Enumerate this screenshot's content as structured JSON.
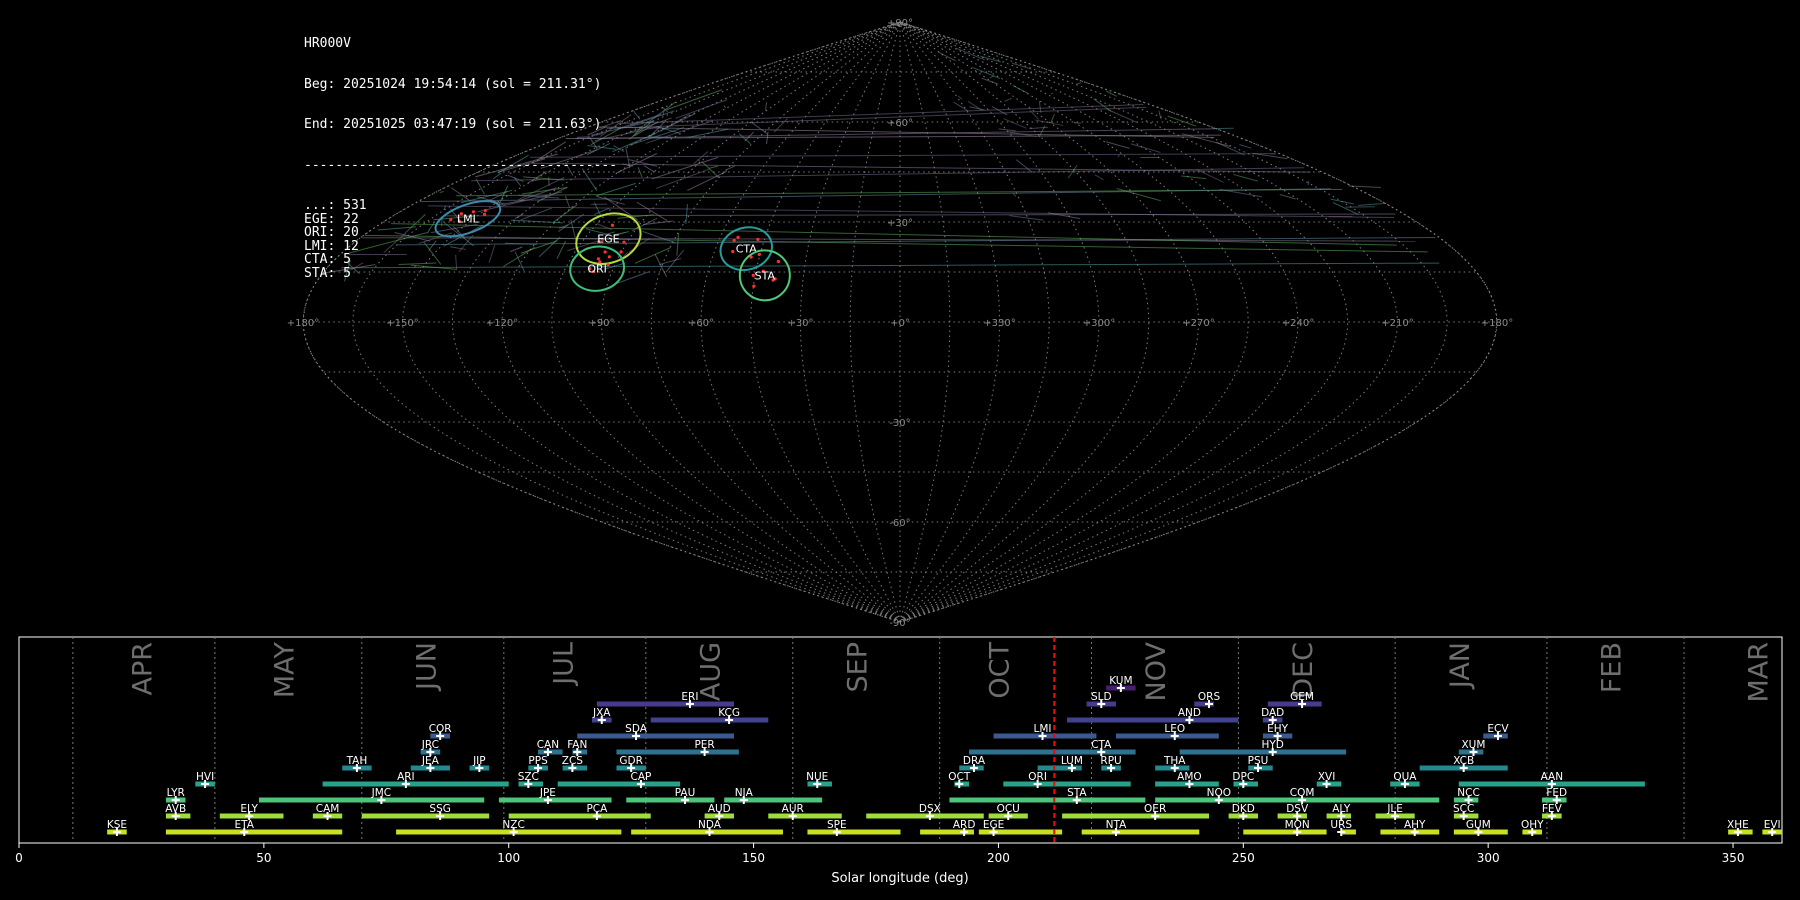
{
  "header": {
    "station": "HR000V",
    "begin": "Beg: 20251024 19:54:14 (sol = 211.31°)",
    "end": "End: 20251025 03:47:19 (sol = 211.63°)",
    "separator": "----------------------------------------",
    "counts": [
      {
        "code": "...",
        "n": 531
      },
      {
        "code": "EGE",
        "n": 22
      },
      {
        "code": "ORI",
        "n": 20
      },
      {
        "code": "LMI",
        "n": 12
      },
      {
        "code": "CTA",
        "n": 5
      },
      {
        "code": "STA",
        "n": 5
      }
    ]
  },
  "sky_map": {
    "projection": "sinusoidal",
    "lat_labels": [
      "+90°",
      "+60°",
      "+30°",
      "-30°",
      "-60°",
      "-90°"
    ],
    "lon_labels": [
      "+180°",
      "+150°",
      "+120°",
      "+90°",
      "+60°",
      "+30°",
      "+0°",
      "+330°",
      "+300°",
      "+270°",
      "+240°",
      "+210°",
      "+180°"
    ],
    "showers": [
      {
        "code": "LML",
        "lon": 152,
        "lat": 31,
        "color": "#3b8bb0"
      },
      {
        "code": "EGE",
        "lon": 97,
        "lat": 25,
        "color": "#b3dc3c"
      },
      {
        "code": "ORI",
        "lon": 95,
        "lat": 16,
        "color": "#3bbf7a"
      },
      {
        "code": "CTA",
        "lon": 50,
        "lat": 22,
        "color": "#2a9a9a"
      },
      {
        "code": "STA",
        "lon": 42,
        "lat": 14,
        "color": "#50c878"
      }
    ]
  },
  "chart_data": {
    "type": "timeline",
    "xlabel": "Solar longitude (deg)",
    "xlim": [
      0,
      360
    ],
    "xticks": [
      0,
      50,
      100,
      150,
      200,
      250,
      300,
      350
    ],
    "months": [
      {
        "label": "APR",
        "sol": 25
      },
      {
        "label": "MAY",
        "sol": 54
      },
      {
        "label": "JUN",
        "sol": 83
      },
      {
        "label": "JUL",
        "sol": 111
      },
      {
        "label": "AUG",
        "sol": 141
      },
      {
        "label": "SEP",
        "sol": 171
      },
      {
        "label": "OCT",
        "sol": 200
      },
      {
        "label": "NOV",
        "sol": 232
      },
      {
        "label": "DEC",
        "sol": 262
      },
      {
        "label": "JAN",
        "sol": 294
      },
      {
        "label": "FEB",
        "sol": 325
      },
      {
        "label": "MAR",
        "sol": 355
      }
    ],
    "month_dividers": [
      11,
      40,
      70,
      99,
      128,
      158,
      188,
      219,
      249,
      281,
      312,
      340
    ],
    "current_sol": 211.4,
    "showers": [
      {
        "code": "KSE",
        "start": 18,
        "end": 22,
        "peak": 20,
        "row": 0
      },
      {
        "code": "ETA",
        "start": 30,
        "end": 66,
        "peak": 46,
        "row": 0
      },
      {
        "code": "NZC",
        "start": 77,
        "end": 123,
        "peak": 101,
        "row": 0
      },
      {
        "code": "NDA",
        "start": 125,
        "end": 156,
        "peak": 141,
        "row": 0
      },
      {
        "code": "SPE",
        "start": 161,
        "end": 180,
        "peak": 167,
        "row": 0
      },
      {
        "code": "ARD",
        "start": 184,
        "end": 195,
        "peak": 193,
        "row": 0
      },
      {
        "code": "EGE",
        "start": 196,
        "end": 213,
        "peak": 199,
        "row": 0
      },
      {
        "code": "NTA",
        "start": 217,
        "end": 241,
        "peak": 224,
        "row": 0
      },
      {
        "code": "MON",
        "start": 250,
        "end": 267,
        "peak": 261,
        "row": 0
      },
      {
        "code": "URS",
        "start": 270,
        "end": 273,
        "peak": 270,
        "row": 0
      },
      {
        "code": "AHY",
        "start": 278,
        "end": 290,
        "peak": 285,
        "row": 0
      },
      {
        "code": "GUM",
        "start": 293,
        "end": 304,
        "peak": 298,
        "row": 0
      },
      {
        "code": "OHY",
        "start": 307,
        "end": 311,
        "peak": 309,
        "row": 0
      },
      {
        "code": "XHE",
        "start": 349,
        "end": 354,
        "peak": 351,
        "row": 0
      },
      {
        "code": "EVI",
        "start": 356,
        "end": 360,
        "peak": 358,
        "row": 0
      },
      {
        "code": "AVB",
        "start": 30,
        "end": 35,
        "peak": 32,
        "row": 1
      },
      {
        "code": "ELY",
        "start": 41,
        "end": 54,
        "peak": 47,
        "row": 1
      },
      {
        "code": "CAM",
        "start": 60,
        "end": 66,
        "peak": 63,
        "row": 1
      },
      {
        "code": "SSG",
        "start": 70,
        "end": 96,
        "peak": 86,
        "row": 1
      },
      {
        "code": "PCA",
        "start": 100,
        "end": 129,
        "peak": 118,
        "row": 1
      },
      {
        "code": "AUD",
        "start": 140,
        "end": 146,
        "peak": 143,
        "row": 1
      },
      {
        "code": "AUR",
        "start": 153,
        "end": 168,
        "peak": 158,
        "row": 1
      },
      {
        "code": "DSX",
        "start": 173,
        "end": 197,
        "peak": 186,
        "row": 1
      },
      {
        "code": "OCU",
        "start": 198,
        "end": 206,
        "peak": 202,
        "row": 1
      },
      {
        "code": "OER",
        "start": 213,
        "end": 243,
        "peak": 232,
        "row": 1
      },
      {
        "code": "DKD",
        "start": 247,
        "end": 253,
        "peak": 250,
        "row": 1
      },
      {
        "code": "DSV",
        "start": 257,
        "end": 263,
        "peak": 261,
        "row": 1
      },
      {
        "code": "ALY",
        "start": 267,
        "end": 272,
        "peak": 270,
        "row": 1
      },
      {
        "code": "JLE",
        "start": 277,
        "end": 285,
        "peak": 281,
        "row": 1
      },
      {
        "code": "SCC",
        "start": 293,
        "end": 298,
        "peak": 295,
        "row": 1
      },
      {
        "code": "FEV",
        "start": 311,
        "end": 315,
        "peak": 313,
        "row": 1
      },
      {
        "code": "LYR",
        "start": 30,
        "end": 34,
        "peak": 32,
        "row": 2
      },
      {
        "code": "JMC",
        "start": 49,
        "end": 95,
        "peak": 74,
        "row": 2
      },
      {
        "code": "JPE",
        "start": 98,
        "end": 121,
        "peak": 108,
        "row": 2
      },
      {
        "code": "PAU",
        "start": 124,
        "end": 142,
        "peak": 136,
        "row": 2
      },
      {
        "code": "NIA",
        "start": 144,
        "end": 164,
        "peak": 148,
        "row": 2
      },
      {
        "code": "STA",
        "start": 190,
        "end": 230,
        "peak": 216,
        "row": 2
      },
      {
        "code": "COM",
        "start": 233,
        "end": 290,
        "peak": 262,
        "row": 2
      },
      {
        "code": "NOO",
        "start": 232,
        "end": 249,
        "peak": 245,
        "row": 2
      },
      {
        "code": "NCC",
        "start": 293,
        "end": 298,
        "peak": 296,
        "row": 2
      },
      {
        "code": "FED",
        "start": 311,
        "end": 316,
        "peak": 314,
        "row": 2
      },
      {
        "code": "HVI",
        "start": 36,
        "end": 40,
        "peak": 38,
        "row": 3
      },
      {
        "code": "ARI",
        "start": 62,
        "end": 100,
        "peak": 79,
        "row": 3
      },
      {
        "code": "SZC",
        "start": 102,
        "end": 107,
        "peak": 104,
        "row": 3
      },
      {
        "code": "CAP",
        "start": 110,
        "end": 135,
        "peak": 127,
        "row": 3
      },
      {
        "code": "NUE",
        "start": 161,
        "end": 166,
        "peak": 163,
        "row": 3
      },
      {
        "code": "OCT",
        "start": 191,
        "end": 194,
        "peak": 192,
        "row": 3
      },
      {
        "code": "ORI",
        "start": 201,
        "end": 227,
        "peak": 208,
        "row": 3
      },
      {
        "code": "AMO",
        "start": 232,
        "end": 245,
        "peak": 239,
        "row": 3
      },
      {
        "code": "DPC",
        "start": 248,
        "end": 253,
        "peak": 250,
        "row": 3
      },
      {
        "code": "XVI",
        "start": 265,
        "end": 270,
        "peak": 267,
        "row": 3
      },
      {
        "code": "QUA",
        "start": 280,
        "end": 286,
        "peak": 283,
        "row": 3
      },
      {
        "code": "AAN",
        "start": 294,
        "end": 332,
        "peak": 313,
        "row": 3
      },
      {
        "code": "TAH",
        "start": 66,
        "end": 72,
        "peak": 69,
        "row": 4
      },
      {
        "code": "JEA",
        "start": 80,
        "end": 88,
        "peak": 84,
        "row": 4
      },
      {
        "code": "JIP",
        "start": 92,
        "end": 96,
        "peak": 94,
        "row": 4
      },
      {
        "code": "PPS",
        "start": 104,
        "end": 108,
        "peak": 106,
        "row": 4
      },
      {
        "code": "ZCS",
        "start": 111,
        "end": 116,
        "peak": 113,
        "row": 4
      },
      {
        "code": "GDR",
        "start": 122,
        "end": 128,
        "peak": 125,
        "row": 4
      },
      {
        "code": "DRA",
        "start": 192,
        "end": 197,
        "peak": 195,
        "row": 4
      },
      {
        "code": "LUM",
        "start": 208,
        "end": 217,
        "peak": 215,
        "row": 4
      },
      {
        "code": "RPU",
        "start": 221,
        "end": 225,
        "peak": 223,
        "row": 4
      },
      {
        "code": "THA",
        "start": 232,
        "end": 239,
        "peak": 236,
        "row": 4
      },
      {
        "code": "PSU",
        "start": 251,
        "end": 256,
        "peak": 253,
        "row": 4
      },
      {
        "code": "XCB",
        "start": 286,
        "end": 304,
        "peak": 295,
        "row": 4
      },
      {
        "code": "JRC",
        "start": 82,
        "end": 86,
        "peak": 84,
        "row": 5
      },
      {
        "code": "CAN",
        "start": 106,
        "end": 111,
        "peak": 108,
        "row": 5
      },
      {
        "code": "FAN",
        "start": 113,
        "end": 116,
        "peak": 114,
        "row": 5
      },
      {
        "code": "PER",
        "start": 122,
        "end": 147,
        "peak": 140,
        "row": 5
      },
      {
        "code": "CTA",
        "start": 194,
        "end": 228,
        "peak": 221,
        "row": 5
      },
      {
        "code": "HYD",
        "start": 237,
        "end": 271,
        "peak": 256,
        "row": 5
      },
      {
        "code": "XUM",
        "start": 294,
        "end": 299,
        "peak": 297,
        "row": 5
      },
      {
        "code": "COR",
        "start": 84,
        "end": 88,
        "peak": 86,
        "row": 6
      },
      {
        "code": "SDA",
        "start": 114,
        "end": 146,
        "peak": 126,
        "row": 6
      },
      {
        "code": "LMI",
        "start": 199,
        "end": 220,
        "peak": 209,
        "row": 6
      },
      {
        "code": "LEO",
        "start": 224,
        "end": 245,
        "peak": 236,
        "row": 6
      },
      {
        "code": "EHY",
        "start": 254,
        "end": 260,
        "peak": 257,
        "row": 6
      },
      {
        "code": "ECV",
        "start": 299,
        "end": 304,
        "peak": 302,
        "row": 6
      },
      {
        "code": "JXA",
        "start": 117,
        "end": 121,
        "peak": 119,
        "row": 7
      },
      {
        "code": "KCG",
        "start": 129,
        "end": 153,
        "peak": 145,
        "row": 7
      },
      {
        "code": "AND",
        "start": 214,
        "end": 249,
        "peak": 239,
        "row": 7
      },
      {
        "code": "DAD",
        "start": 254,
        "end": 258,
        "peak": 256,
        "row": 7
      },
      {
        "code": "ERI",
        "start": 118,
        "end": 146,
        "peak": 137,
        "row": 8
      },
      {
        "code": "SLD",
        "start": 218,
        "end": 224,
        "peak": 221,
        "row": 8
      },
      {
        "code": "ORS",
        "start": 240,
        "end": 244,
        "peak": 243,
        "row": 8
      },
      {
        "code": "GEM",
        "start": 255,
        "end": 266,
        "peak": 262,
        "row": 8
      },
      {
        "code": "KUM",
        "start": 222,
        "end": 228,
        "peak": 225,
        "row": 9
      }
    ]
  }
}
